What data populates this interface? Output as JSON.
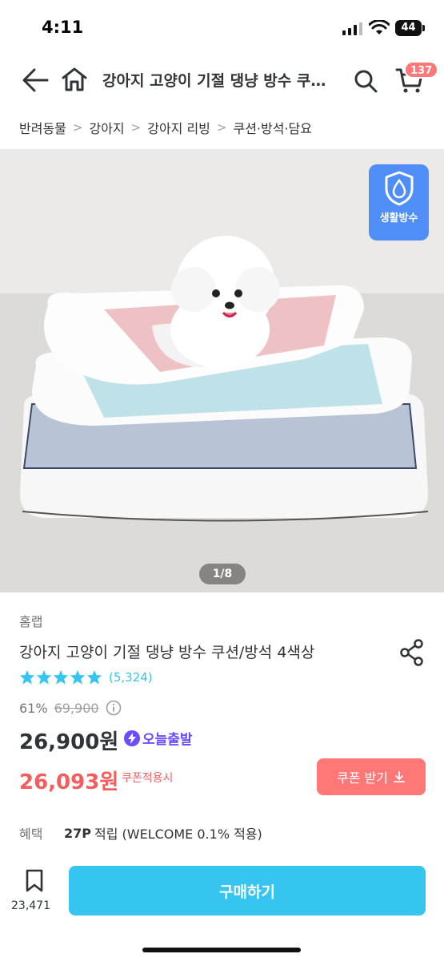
{
  "status_bar": {
    "time": "4:11",
    "battery": "44"
  },
  "header": {
    "title": "강아지 고양이 기절 댕냥 방수 쿠…",
    "cart_count": "137"
  },
  "breadcrumb": [
    "반려동물",
    "강아지",
    "강아지 리빙",
    "쿠션·방석·담요"
  ],
  "gallery": {
    "badge_label": "생활방수",
    "counter": "1/8"
  },
  "product": {
    "brand": "홈랩",
    "name": "강아지 고양이 기절 댕냥 방수 쿠션/방석 4색상",
    "rating": 5,
    "review_count": "(5,324)",
    "discount_percent": "61%",
    "original_price": "69,900",
    "price": "26,900원",
    "today_delivery": "오늘출발",
    "coupon_price": "26,093원",
    "coupon_label": "쿠폰적용시",
    "coupon_button": "쿠폰 받기"
  },
  "benefit": {
    "label": "혜택",
    "points": "27P",
    "text": "적립 (WELCOME 0.1% 적용)"
  },
  "bottom_bar": {
    "bookmark_count": "23,471",
    "buy_label": "구매하기"
  },
  "colors": {
    "accent": "#35c5f0",
    "coupon": "#ff7777",
    "today_purple": "#6a4dff"
  }
}
